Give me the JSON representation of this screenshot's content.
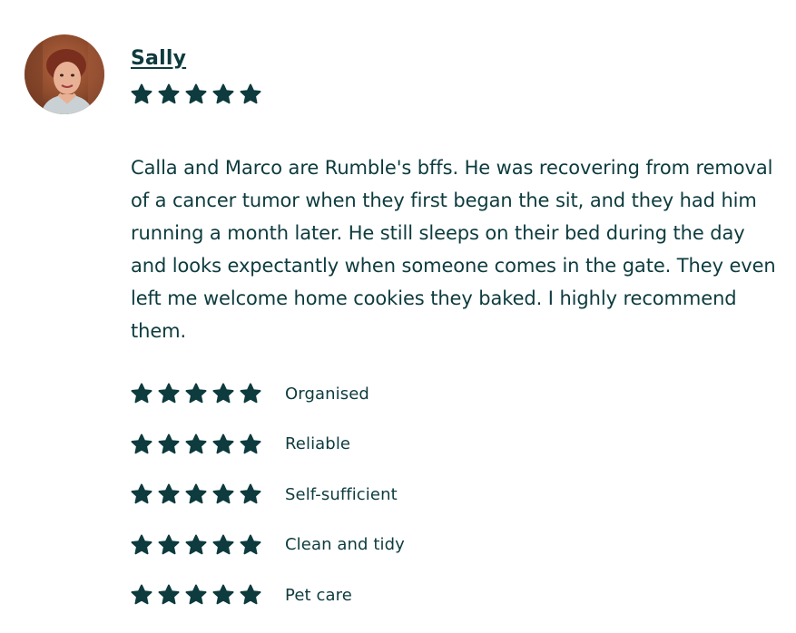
{
  "reviewer": {
    "name": "Sally",
    "overall_rating": 5,
    "max_rating": 5
  },
  "review": {
    "text": "Calla and Marco are Rumble's bffs. He was recovering from removal of a cancer tumor when they first began the sit, and they had him running a month later. He still sleeps on their bed during the day and looks expectantly when someone comes in the gate. They even left me welcome home cookies they baked. I highly recommend them."
  },
  "categories": [
    {
      "label": "Organised",
      "rating": 5
    },
    {
      "label": "Reliable",
      "rating": 5
    },
    {
      "label": "Self-sufficient",
      "rating": 5
    },
    {
      "label": "Clean and tidy",
      "rating": 5
    },
    {
      "label": "Pet care",
      "rating": 5
    }
  ],
  "colors": {
    "primary_text": "#0d3b3e",
    "star_fill": "#0d3b3e",
    "background": "#ffffff"
  },
  "icons": {
    "star": "star-icon",
    "avatar": "avatar-photo"
  }
}
